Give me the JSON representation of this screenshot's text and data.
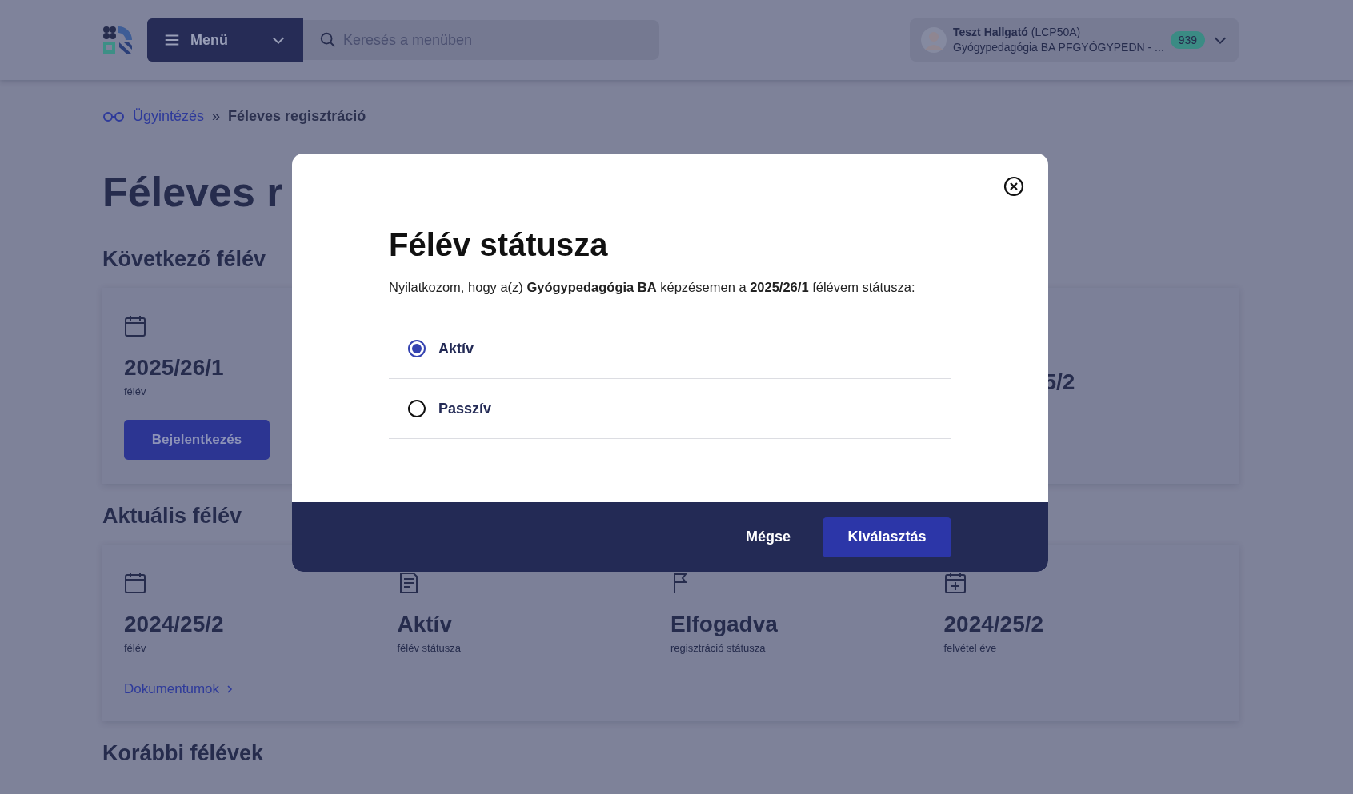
{
  "header": {
    "menu_label": "Menü",
    "search": {
      "placeholder": "Keresés a menüben"
    },
    "user": {
      "name": "Teszt Hallgató",
      "code": "(LCP50A)",
      "program": "Gyógypedagógia BA PFGYÓGYPEDN - ...",
      "badge": "939"
    }
  },
  "breadcrumb": [
    {
      "label": "Ügyintézés",
      "kind": "link"
    },
    {
      "label": "Féleves regisztráció",
      "kind": "current"
    }
  ],
  "breadcrumb_separator": "»",
  "page_title": "Féleves r",
  "sections": [
    {
      "title": "Következő félév",
      "items": [
        {
          "kind": "full",
          "value": "2025/26/1",
          "label": "félév"
        },
        {
          "kind": "clipped",
          "value": "5/2"
        }
      ],
      "action": {
        "kind": "button",
        "label": "Bejelentkezés"
      }
    },
    {
      "title": "Aktuális félév",
      "items": [
        {
          "kind": "full",
          "value": "2024/25/2",
          "label": "félév"
        },
        {
          "kind": "full",
          "value": "Aktív",
          "label": "félév státusza"
        },
        {
          "kind": "full",
          "value": "Elfogadva",
          "label": "regisztráció státusza"
        },
        {
          "kind": "full",
          "value": "2024/25/2",
          "label": "felvétel éve"
        }
      ],
      "action": {
        "kind": "link",
        "label": "Dokumentumok"
      }
    },
    {
      "title": "Korábbi félévek"
    }
  ],
  "modal": {
    "title": "Félév státusza",
    "text": "Nyilatkozom, hogy a(z) **Gyógypedagógia BA** képzésemen a **2025/26/1** félévem státusza:",
    "options": [
      {
        "label": "Aktív",
        "selected": true
      },
      {
        "label": "Passzív",
        "selected": false
      }
    ],
    "buttons": [
      {
        "label": "Mégse",
        "kind": "secondary"
      },
      {
        "label": "Kiválasztás",
        "kind": "primary"
      }
    ]
  }
}
